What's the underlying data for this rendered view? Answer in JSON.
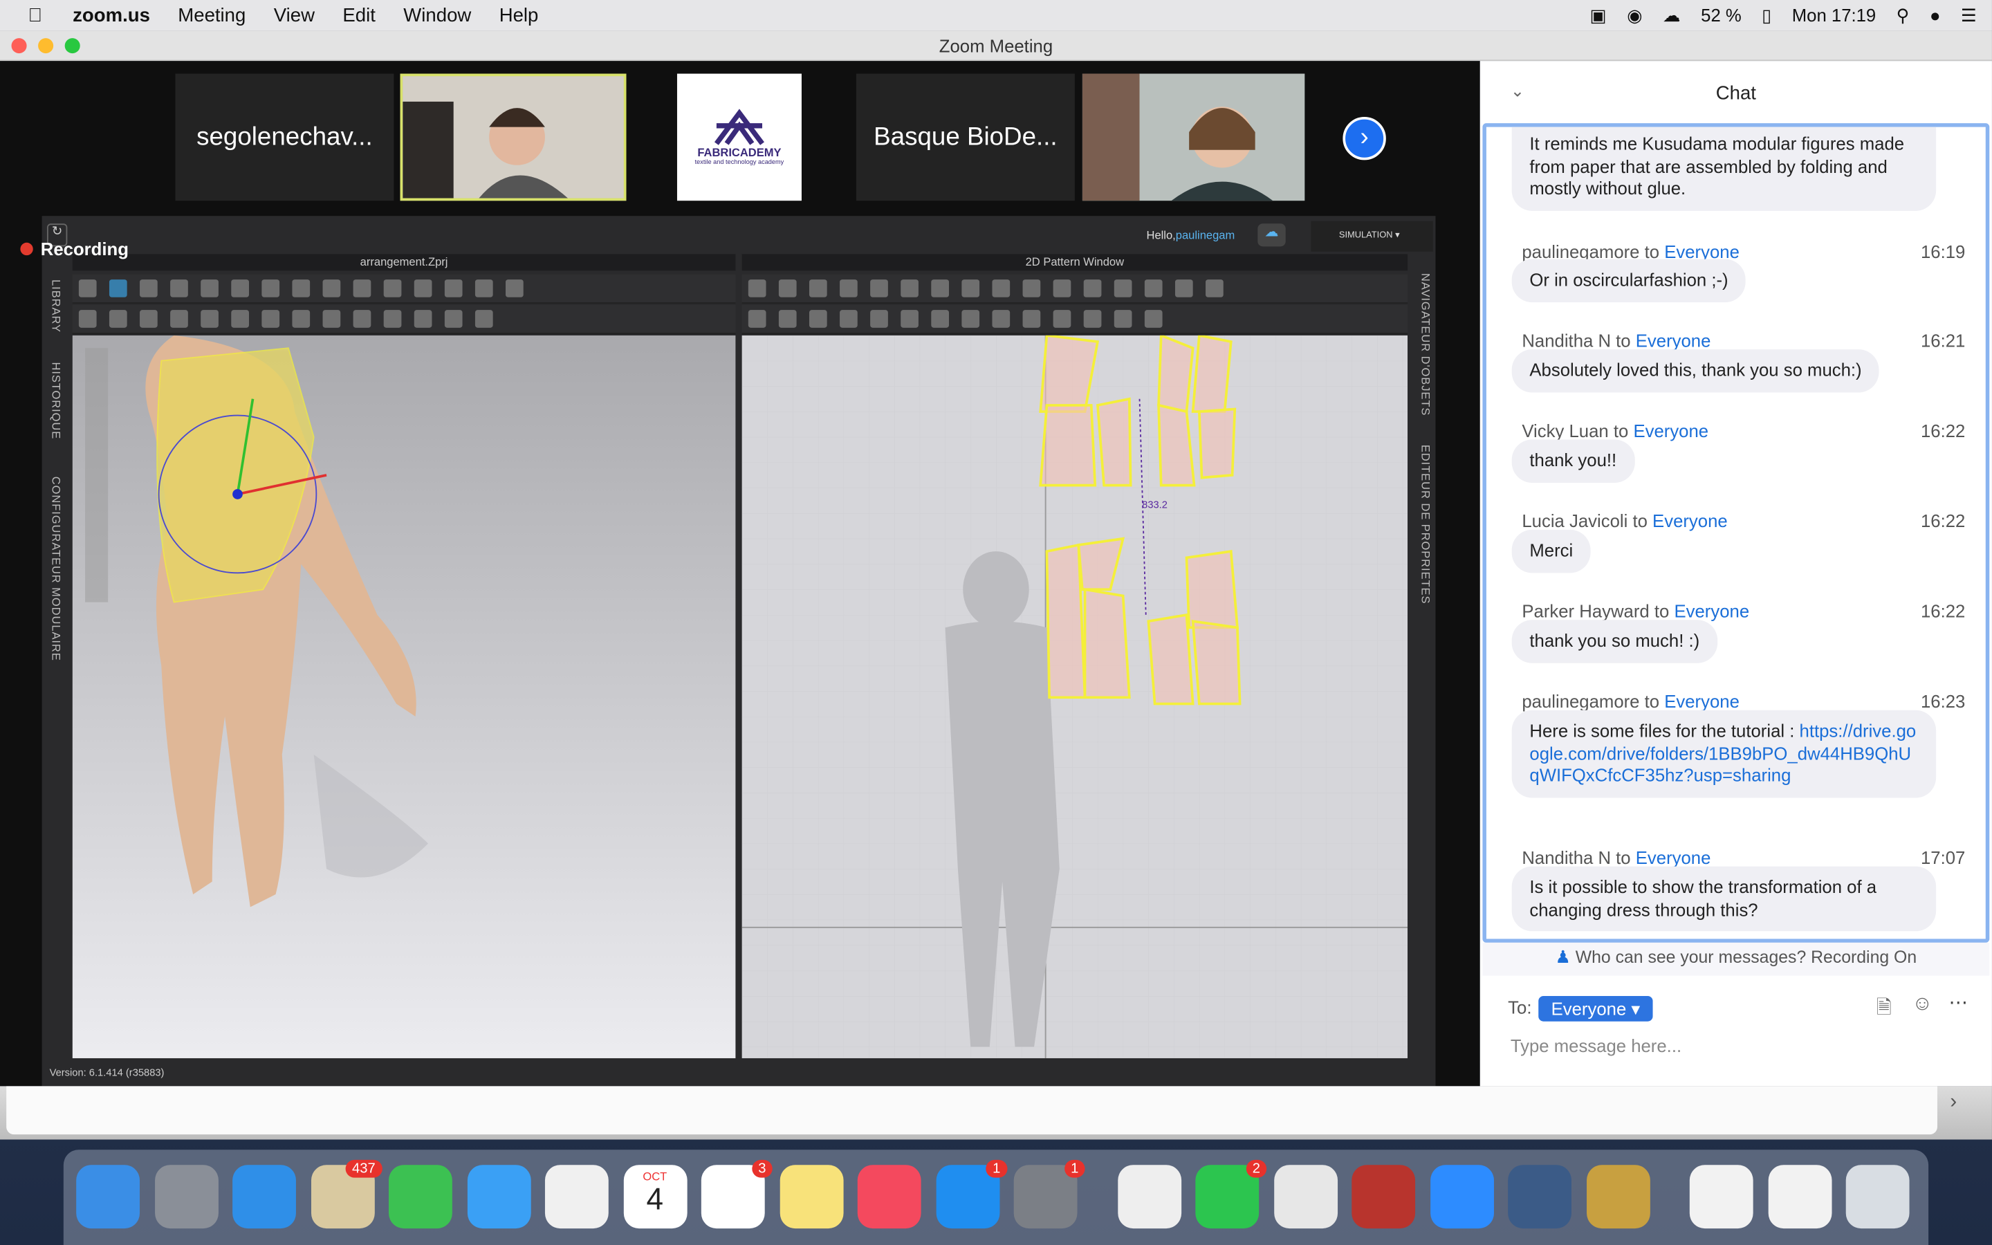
{
  "menubar": {
    "app": "zoom.us",
    "items": [
      "Meeting",
      "View",
      "Edit",
      "Window",
      "Help"
    ],
    "battery": "52 %",
    "clock": "Mon 17:19"
  },
  "window": {
    "title": "Zoom Meeting"
  },
  "participants": [
    {
      "name": "segolenechav..."
    },
    {
      "name": "",
      "video": true
    },
    {
      "name": "FABRICADEMY",
      "sub": "textile and technology academy",
      "logo": true
    },
    {
      "name": "Basque BioDe..."
    },
    {
      "name": "",
      "video": true
    }
  ],
  "recording": "Recording",
  "clo": {
    "hello": "Hello,",
    "user": "paulinegam",
    "mode": "SIMULATION",
    "panel3d": "arrangement.Zprj",
    "panel2d": "2D Pattern Window",
    "left_tabs": [
      "LIBRARY",
      "HISTORIQUE",
      "CONFIGURATEUR MODULAIRE"
    ],
    "right_tabs": [
      "NAVIGATEUR D'OBJETS",
      "EDITEUR DE PROPRIETES"
    ],
    "measure": "833.2",
    "version": "Version: 6.1.414 (r35883)"
  },
  "chat": {
    "title": "Chat",
    "messages": [
      {
        "sender": "",
        "time": "",
        "text": "It reminds me Kusudama modular figures made from paper that are assembled by folding and mostly without glue."
      },
      {
        "sender": "paulinegamore",
        "to": "to",
        "target": "Everyone",
        "time": "16:19",
        "text": "Or in oscircularfashion ;-)"
      },
      {
        "sender": "Nanditha N",
        "to": "to",
        "target": "Everyone",
        "time": "16:21",
        "text": "Absolutely loved this, thank you so much:)"
      },
      {
        "sender": "Vicky Luan",
        "to": "to",
        "target": "Everyone",
        "time": "16:22",
        "text": "thank you!!"
      },
      {
        "sender": "Lucia Javicoli",
        "to": "to",
        "target": "Everyone",
        "time": "16:22",
        "text": "Merci"
      },
      {
        "sender": "Parker Hayward",
        "to": "to",
        "target": "Everyone",
        "time": "16:22",
        "text": "thank you so much! :)"
      },
      {
        "sender": "paulinegamore",
        "to": "to",
        "target": "Everyone",
        "time": "16:23",
        "text": "Here is some files for the tutorial : ",
        "link": "https://drive.google.com/drive/folders/1BB9bPO_dw44HB9QhUqWIFQxCfcCF35hz?usp=sharing"
      },
      {
        "sender": "Nanditha N",
        "to": "to",
        "target": "Everyone",
        "time": "17:07",
        "text": "Is it possible to show the transformation of a changing dress through this?"
      }
    ],
    "privacy": "Who can see your messages? Recording On",
    "to_label": "To:",
    "to_value": "Everyone",
    "placeholder": "Type message here..."
  },
  "dock": [
    {
      "name": "Finder",
      "color": "#3a8ee6"
    },
    {
      "name": "Launchpad",
      "color": "#8a8f98"
    },
    {
      "name": "Safari",
      "color": "#2f8fe8"
    },
    {
      "name": "Mail",
      "color": "#d9c9a0",
      "badge": "437"
    },
    {
      "name": "FaceTime",
      "color": "#3cc152"
    },
    {
      "name": "Messages",
      "color": "#3aa0f5"
    },
    {
      "name": "Photos",
      "color": "#f0f0f0"
    },
    {
      "name": "Calendar",
      "color": "#ffffff",
      "month": "OCT",
      "day": "4"
    },
    {
      "name": "Reminders",
      "color": "#ffffff",
      "badge": "3"
    },
    {
      "name": "Notes",
      "color": "#f8e27a"
    },
    {
      "name": "Music",
      "color": "#f4495e"
    },
    {
      "name": "App Store",
      "color": "#1f8ef0",
      "badge": "1"
    },
    {
      "name": "System Preferences",
      "color": "#7b7f86",
      "badge": "1"
    },
    {
      "name": "TextEdit",
      "color": "#eeeeee"
    },
    {
      "name": "WhatsApp",
      "color": "#2cc54f",
      "badge": "2"
    },
    {
      "name": "Chrome",
      "color": "#e7e7e7"
    },
    {
      "name": "Photo Booth",
      "color": "#b8342d"
    },
    {
      "name": "Zoom",
      "color": "#2d8cff"
    },
    {
      "name": "QuickTime",
      "color": "#3b5b87"
    },
    {
      "name": "CLO",
      "color": "#c8a040"
    },
    {
      "name": "Document",
      "color": "#f2f2f2"
    },
    {
      "name": "Document",
      "color": "#f2f2f2"
    },
    {
      "name": "Trash",
      "color": "#d8dde3"
    }
  ],
  "colors": {
    "accent": "#1a6ed8",
    "pattern": "#f4ef3a",
    "recording": "#e23b2e"
  }
}
